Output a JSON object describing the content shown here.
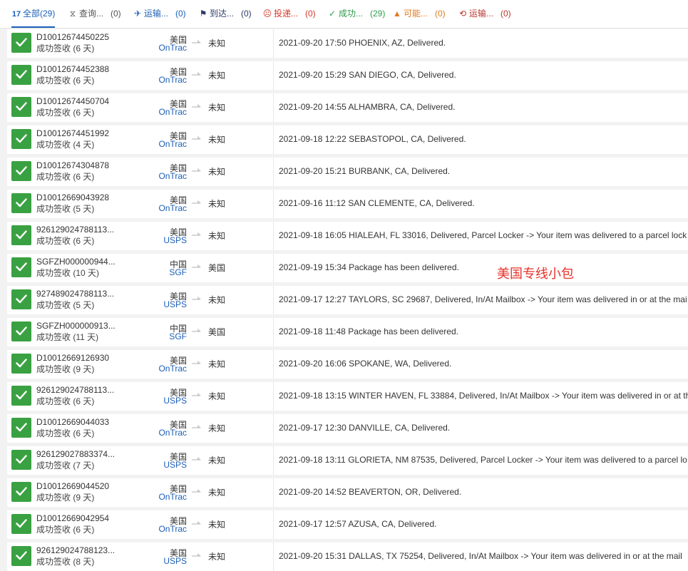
{
  "tabs": [
    {
      "label": "全部",
      "count": "(29)",
      "icon": "all-icon"
    },
    {
      "label": "查询...",
      "count": "(0)",
      "icon": "hourglass-icon"
    },
    {
      "label": "运输...",
      "count": "(0)",
      "icon": "airplane-icon"
    },
    {
      "label": "到达...",
      "count": "(0)",
      "icon": "flag-icon"
    },
    {
      "label": "投递...",
      "count": "(0)",
      "icon": "sad-face-icon"
    },
    {
      "label": "成功...",
      "count": "(29)",
      "icon": "check-icon"
    },
    {
      "label": "可能...",
      "count": "(0)",
      "icon": "warning-icon"
    },
    {
      "label": "运输...",
      "count": "(0)",
      "icon": "clock-back-icon"
    }
  ],
  "shipments": [
    {
      "tracking": "D10012674450225",
      "status": "成功签收 (6 天)",
      "country": "美国",
      "carrier": "OnTrac",
      "destination": "未知",
      "event": "2021-09-20 17:50 PHOENIX, AZ, Delivered."
    },
    {
      "tracking": "D10012674452388",
      "status": "成功签收 (6 天)",
      "country": "美国",
      "carrier": "OnTrac",
      "destination": "未知",
      "event": "2021-09-20 15:29 SAN DIEGO, CA, Delivered."
    },
    {
      "tracking": "D10012674450704",
      "status": "成功签收 (6 天)",
      "country": "美国",
      "carrier": "OnTrac",
      "destination": "未知",
      "event": "2021-09-20 14:55 ALHAMBRA, CA, Delivered."
    },
    {
      "tracking": "D10012674451992",
      "status": "成功签收 (4 天)",
      "country": "美国",
      "carrier": "OnTrac",
      "destination": "未知",
      "event": "2021-09-18 12:22 SEBASTOPOL, CA, Delivered."
    },
    {
      "tracking": "D10012674304878",
      "status": "成功签收 (6 天)",
      "country": "美国",
      "carrier": "OnTrac",
      "destination": "未知",
      "event": "2021-09-20 15:21 BURBANK, CA, Delivered."
    },
    {
      "tracking": "D10012669043928",
      "status": "成功签收 (5 天)",
      "country": "美国",
      "carrier": "OnTrac",
      "destination": "未知",
      "event": "2021-09-16 11:12 SAN CLEMENTE, CA, Delivered."
    },
    {
      "tracking": "926129024788113...",
      "status": "成功签收 (6 天)",
      "country": "美国",
      "carrier": "USPS",
      "destination": "未知",
      "event": "2021-09-18 16:05 HIALEAH, FL 33016, Delivered, Parcel Locker -> Your item was delivered to a parcel lock"
    },
    {
      "tracking": "SGFZH000000944...",
      "status": "成功签收 (10 天)",
      "country": "中国",
      "carrier": "SGF",
      "destination": "美国",
      "event": "2021-09-19 15:34 Package has been delivered."
    },
    {
      "tracking": "927489024788113...",
      "status": "成功签收 (5 天)",
      "country": "美国",
      "carrier": "USPS",
      "destination": "未知",
      "event": "2021-09-17 12:27 TAYLORS, SC 29687, Delivered, In/At Mailbox -> Your item was delivered in or at the mai"
    },
    {
      "tracking": "SGFZH000000913...",
      "status": "成功签收 (11 天)",
      "country": "中国",
      "carrier": "SGF",
      "destination": "美国",
      "event": "2021-09-18 11:48 Package has been delivered."
    },
    {
      "tracking": "D10012669126930",
      "status": "成功签收 (9 天)",
      "country": "美国",
      "carrier": "OnTrac",
      "destination": "未知",
      "event": "2021-09-20 16:06 SPOKANE, WA, Delivered."
    },
    {
      "tracking": "926129024788113...",
      "status": "成功签收 (6 天)",
      "country": "美国",
      "carrier": "USPS",
      "destination": "未知",
      "event": "2021-09-18 13:15 WINTER HAVEN, FL 33884, Delivered, In/At Mailbox -> Your item was delivered in or at th"
    },
    {
      "tracking": "D10012669044033",
      "status": "成功签收 (6 天)",
      "country": "美国",
      "carrier": "OnTrac",
      "destination": "未知",
      "event": "2021-09-17 12:30 DANVILLE, CA, Delivered."
    },
    {
      "tracking": "926129027883374...",
      "status": "成功签收 (7 天)",
      "country": "美国",
      "carrier": "USPS",
      "destination": "未知",
      "event": "2021-09-18 13:11 GLORIETA, NM 87535, Delivered, Parcel Locker -> Your item was delivered to a parcel lo"
    },
    {
      "tracking": "D10012669044520",
      "status": "成功签收 (9 天)",
      "country": "美国",
      "carrier": "OnTrac",
      "destination": "未知",
      "event": "2021-09-20 14:52 BEAVERTON, OR, Delivered."
    },
    {
      "tracking": "D10012669042954",
      "status": "成功签收 (6 天)",
      "country": "美国",
      "carrier": "OnTrac",
      "destination": "未知",
      "event": "2021-09-17 12:57 AZUSA, CA, Delivered."
    },
    {
      "tracking": "926129024788123...",
      "status": "成功签收 (8 天)",
      "country": "美国",
      "carrier": "USPS",
      "destination": "未知",
      "event": "2021-09-20 15:31 DALLAS, TX 75254, Delivered, In/At Mailbox -> Your item was delivered in or at the mail"
    }
  ],
  "annotation": "美国专线小包",
  "colors": {
    "accent": "#1b5fb7",
    "success": "#3aa142",
    "annotation": "#e8312a"
  }
}
